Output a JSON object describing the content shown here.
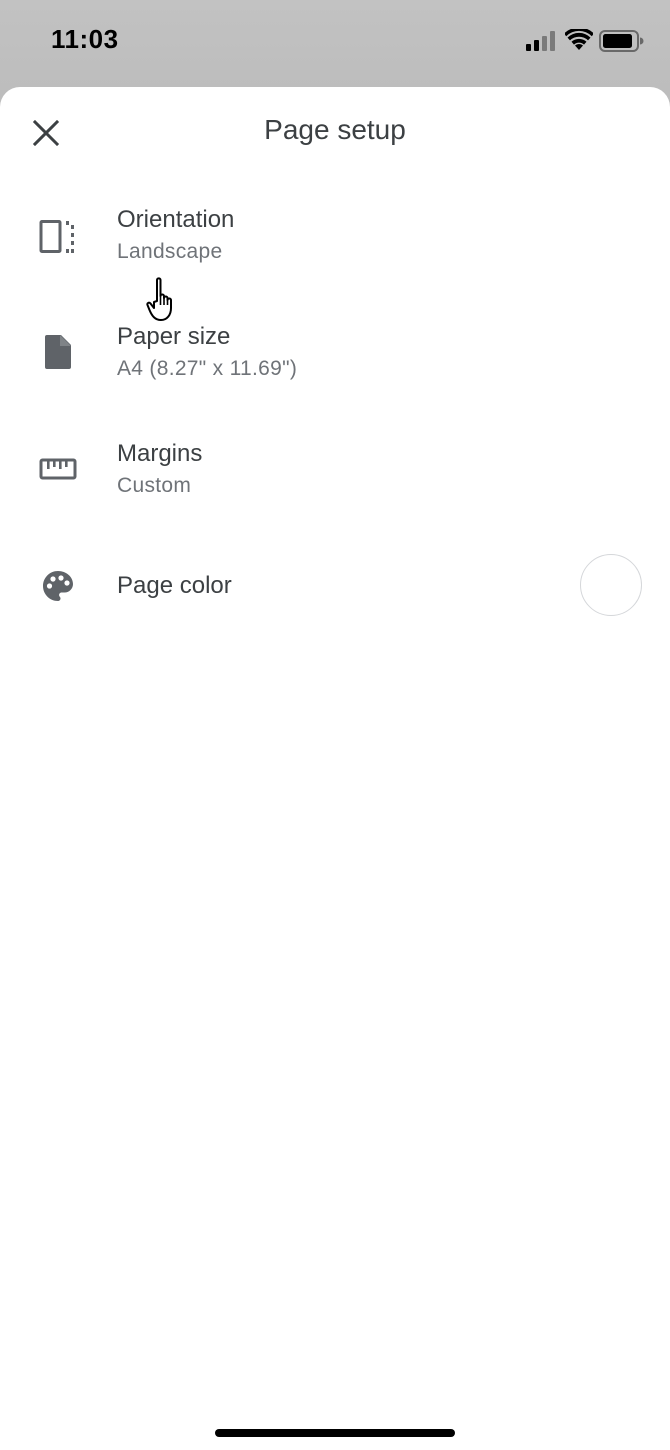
{
  "status_bar": {
    "time": "11:03"
  },
  "sheet": {
    "title": "Page setup",
    "close_icon": "close-icon"
  },
  "settings": [
    {
      "label": "Orientation",
      "value": "Landscape",
      "icon": "orientation-icon"
    },
    {
      "label": "Paper size",
      "value": "A4 (8.27\" x 11.69\")",
      "icon": "document-icon"
    },
    {
      "label": "Margins",
      "value": "Custom",
      "icon": "ruler-icon"
    },
    {
      "label": "Page color",
      "icon": "palette-icon",
      "color": "#ffffff"
    }
  ],
  "colors": {
    "text_primary": "#3c4043",
    "text_secondary": "#6f7378",
    "icon": "#5f6368"
  }
}
